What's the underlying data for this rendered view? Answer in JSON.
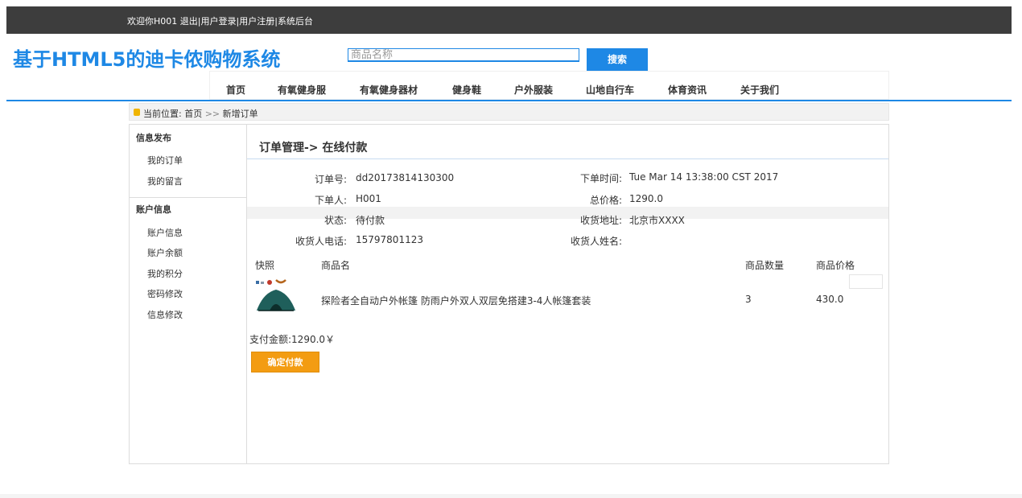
{
  "topbar": {
    "welcome": "欢迎你H001",
    "logout": "退出|",
    "login": "用户登录|",
    "register": "用户注册|",
    "admin": "系统后台"
  },
  "header": {
    "logo": "基于HTML5的迪卡侬购物系统",
    "search_placeholder": "商品名称",
    "search_button": "搜索"
  },
  "nav": {
    "items": [
      "首页",
      "有氧健身服",
      "有氧健身器材",
      "健身鞋",
      "户外服装",
      "山地自行车",
      "体育资讯",
      "关于我们"
    ]
  },
  "breadcrumb": {
    "label": "当前位置:",
    "home": "首页",
    "sep": ">>",
    "current": "新增订单"
  },
  "sidebar": {
    "section1": "信息发布",
    "section1_items": [
      "我的订单",
      "我的留言"
    ],
    "section2": "账户信息",
    "section2_items": [
      "账户信息",
      "账户余额",
      "我的积分",
      "密码修改",
      "信息修改"
    ]
  },
  "main": {
    "title": "订单管理-> 在线付款",
    "order_no_label": "订单号:",
    "order_no": "dd20173814130300",
    "order_time_label": "下单时间:",
    "order_time": "Tue Mar 14 13:38:00 CST 2017",
    "orderer_label": "下单人:",
    "orderer": "H001",
    "total_label": "总价格:",
    "total": "1290.0",
    "status_label": "状态:",
    "status": "待付款",
    "address_label": "收货地址:",
    "address": "北京市XXXX",
    "phone_label": "收货人电话:",
    "phone": "15797801123",
    "receiver_label": "收货人姓名:",
    "receiver": "",
    "table_headers": [
      "快照",
      "商品名",
      "商品数量",
      "商品价格"
    ],
    "item_name": "探险者全自动户外帐篷 防雨户外双人双层免搭建3-4人帐篷套装",
    "item_qty": "3",
    "item_price": "430.0",
    "pay_amount": "支付金额:1290.0￥",
    "pay_button": "确定付款"
  }
}
